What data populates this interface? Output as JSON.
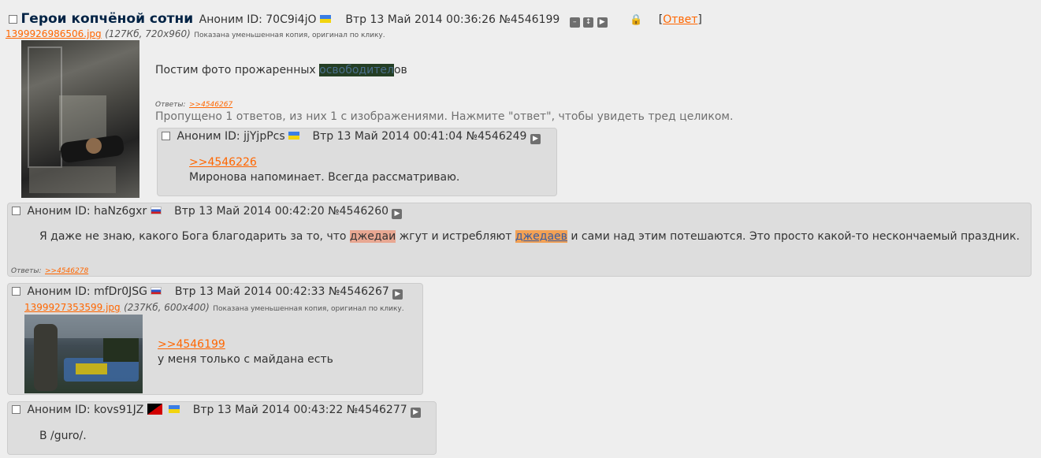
{
  "op": {
    "subject": "Герои копчёной сотни",
    "name": "Аноним",
    "id": "ID: 70C9i4jO",
    "date": "Втр 13 Май 2014 00:36:26",
    "num": "№4546199",
    "reply_link": "Ответ",
    "file_name": "1399926986506.jpg",
    "file_info": "(127Кб, 720x960)",
    "file_note": "Показана уменьшенная копия, оригинал по клику.",
    "text_before": "Постим фото прожаренных ",
    "text_hl": "освободител",
    "text_after": "ов",
    "replies_label": "Ответы:",
    "replies_link": ">>4546267",
    "omitted": "Пропущено 1 ответов, из них 1 с изображениями. Нажмите \"ответ\", чтобы увидеть тред целиком."
  },
  "posts": [
    {
      "name": "Аноним",
      "id": "ID: jjYjpPcs",
      "date": "Втр 13 Май 2014 00:41:04",
      "num": "№4546249",
      "quote": ">>4546226",
      "text": "Миронова напоминает. Всегда рассматриваю."
    },
    {
      "name": "Аноним",
      "id": "ID: haNz6gxr",
      "date": "Втр 13 Май 2014 00:42:20",
      "num": "№4546260",
      "text_1": "Я даже не знаю, какого Бога благодарить за то, что ",
      "hl_1": "джедаи",
      "text_2": " жгут и истребляют ",
      "hl_2": "джедаев",
      "text_3": " и сами над этим потешаются. Это просто какой-то нескончаемый праздник.",
      "replies_label": "Ответы:",
      "replies_link": ">>4546278"
    },
    {
      "name": "Аноним",
      "id": "ID: mfDr0JSG",
      "date": "Втр 13 Май 2014 00:42:33",
      "num": "№4546267",
      "file_name": "1399927353599.jpg",
      "file_info": "(237Кб, 600x400)",
      "file_note": "Показана уменьшенная копия, оригинал по клику.",
      "quote": ">>4546199",
      "text": "у меня только с майдана есть"
    },
    {
      "name": "Аноним",
      "id": "ID: kovs91JZ",
      "date": "Втр 13 Май 2014 00:43:22",
      "num": "№4546277",
      "text": "В /guro/."
    }
  ]
}
